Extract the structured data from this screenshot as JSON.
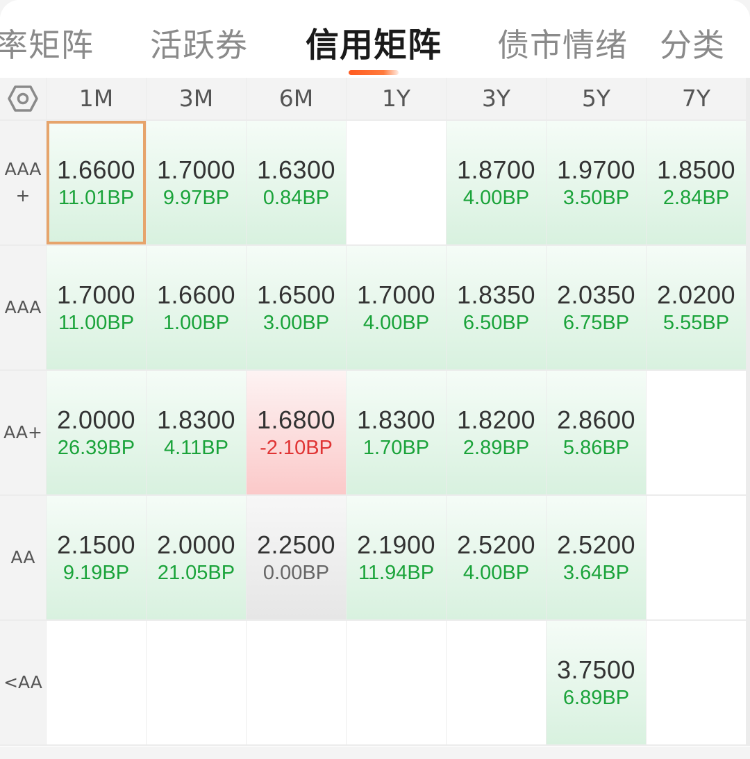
{
  "tabs": [
    {
      "label": "率矩阵",
      "active": false
    },
    {
      "label": "活跃券",
      "active": false
    },
    {
      "label": "信用矩阵",
      "active": true
    },
    {
      "label": "债市情绪",
      "active": false
    },
    {
      "label": "分类",
      "active": false
    }
  ],
  "colors": {
    "accent": "#ff5a1f",
    "up": "#1aa33a",
    "down": "#e03434",
    "selected_border": "#e6a46b"
  },
  "matrix": {
    "settings_icon": "hexagon-nut-icon",
    "columns": [
      "1M",
      "3M",
      "6M",
      "1Y",
      "3Y",
      "5Y",
      "7Y"
    ],
    "rows": [
      {
        "label_line1": "AAA",
        "label_line2": "+",
        "cells": [
          {
            "value": "1.6600",
            "bp": "11.01BP",
            "trend": "up",
            "selected": true
          },
          {
            "value": "1.7000",
            "bp": "9.97BP",
            "trend": "up"
          },
          {
            "value": "1.6300",
            "bp": "0.84BP",
            "trend": "up"
          },
          null,
          {
            "value": "1.8700",
            "bp": "4.00BP",
            "trend": "up"
          },
          {
            "value": "1.9700",
            "bp": "3.50BP",
            "trend": "up"
          },
          {
            "value": "1.8500",
            "bp": "2.84BP",
            "trend": "up"
          }
        ]
      },
      {
        "label_line1": "AAA",
        "label_line2": "",
        "cells": [
          {
            "value": "1.7000",
            "bp": "11.00BP",
            "trend": "up"
          },
          {
            "value": "1.6600",
            "bp": "1.00BP",
            "trend": "up"
          },
          {
            "value": "1.6500",
            "bp": "3.00BP",
            "trend": "up"
          },
          {
            "value": "1.7000",
            "bp": "4.00BP",
            "trend": "up"
          },
          {
            "value": "1.8350",
            "bp": "6.50BP",
            "trend": "up"
          },
          {
            "value": "2.0350",
            "bp": "6.75BP",
            "trend": "up"
          },
          {
            "value": "2.0200",
            "bp": "5.55BP",
            "trend": "up"
          }
        ]
      },
      {
        "label_line1": "AA+",
        "label_line2": "",
        "cells": [
          {
            "value": "2.0000",
            "bp": "26.39BP",
            "trend": "up"
          },
          {
            "value": "1.8300",
            "bp": "4.11BP",
            "trend": "up"
          },
          {
            "value": "1.6800",
            "bp": "-2.10BP",
            "trend": "down"
          },
          {
            "value": "1.8300",
            "bp": "1.70BP",
            "trend": "up"
          },
          {
            "value": "1.8200",
            "bp": "2.89BP",
            "trend": "up"
          },
          {
            "value": "2.8600",
            "bp": "5.86BP",
            "trend": "up"
          },
          null
        ]
      },
      {
        "label_line1": "AA",
        "label_line2": "",
        "cells": [
          {
            "value": "2.1500",
            "bp": "9.19BP",
            "trend": "up"
          },
          {
            "value": "2.0000",
            "bp": "21.05BP",
            "trend": "up"
          },
          {
            "value": "2.2500",
            "bp": "0.00BP",
            "trend": "flat"
          },
          {
            "value": "2.1900",
            "bp": "11.94BP",
            "trend": "up"
          },
          {
            "value": "2.5200",
            "bp": "4.00BP",
            "trend": "up"
          },
          {
            "value": "2.5200",
            "bp": "3.64BP",
            "trend": "up"
          },
          null
        ]
      },
      {
        "label_line1": "<AA",
        "label_line2": "",
        "cells": [
          null,
          null,
          null,
          null,
          null,
          {
            "value": "3.7500",
            "bp": "6.89BP",
            "trend": "up"
          },
          null
        ]
      }
    ]
  }
}
